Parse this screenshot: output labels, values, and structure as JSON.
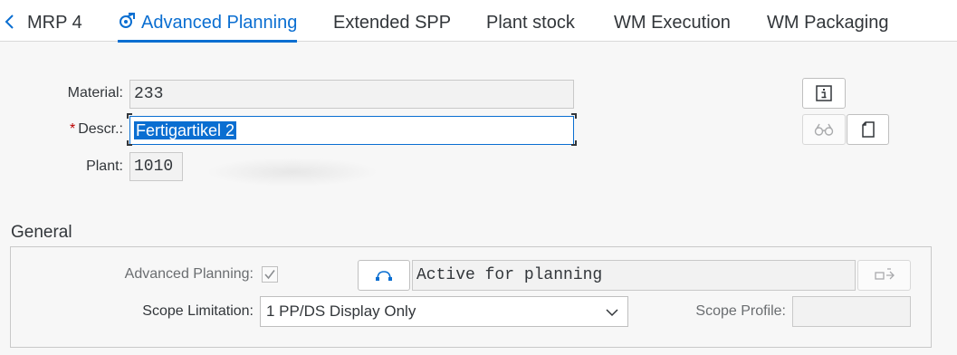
{
  "tabs": [
    {
      "label": "MRP 4",
      "active": false
    },
    {
      "label": "Advanced Planning",
      "active": true
    },
    {
      "label": "Extended SPP",
      "active": false
    },
    {
      "label": "Plant stock",
      "active": false
    },
    {
      "label": "WM Execution",
      "active": false
    },
    {
      "label": "WM Packaging",
      "active": false
    }
  ],
  "header": {
    "material_label": "Material:",
    "material_value": "233",
    "descr_required_marker": "*",
    "descr_label": "Descr.:",
    "descr_value": "Fertigartikel 2",
    "plant_label": "Plant:",
    "plant_value": "1010"
  },
  "general": {
    "title": "General",
    "advanced_planning_label": "Advanced Planning:",
    "advanced_planning_checked": true,
    "status_text": "Active for planning",
    "scope_limitation_label": "Scope Limitation:",
    "scope_limitation_value": "1 PP/DS Display Only",
    "scope_profile_label": "Scope Profile:",
    "scope_profile_value": ""
  },
  "icons": {
    "back": "chevron-left-icon",
    "tab": "planning-icon",
    "info": "info-icon",
    "glasses": "glasses-icon",
    "document": "document-icon",
    "network": "network-icon",
    "transfer": "transfer-icon",
    "dropdown": "chevron-down-icon"
  },
  "colors": {
    "accent": "#0a6ed1",
    "required": "#bb0000",
    "background": "#f7f7f7"
  }
}
